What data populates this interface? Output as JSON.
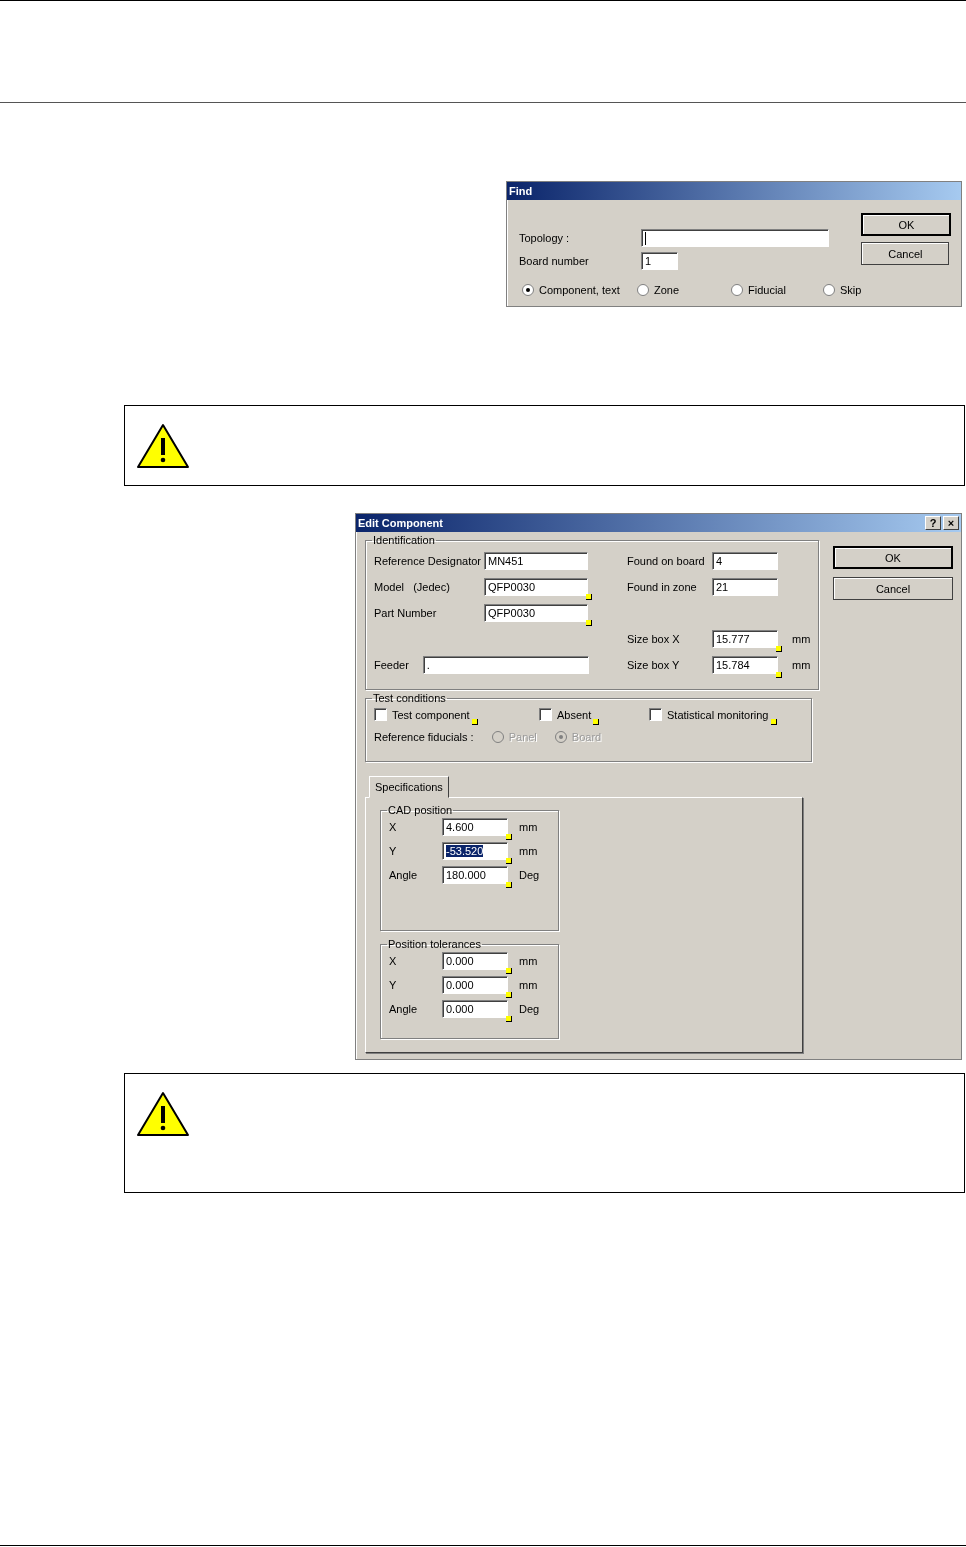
{
  "find_dialog": {
    "title": "Find",
    "fields": [
      {
        "label": "Topology :",
        "focused": true
      },
      {
        "label": "Board number",
        "value": "1",
        "focused": false
      }
    ],
    "options": [
      {
        "label": "Component, text",
        "selected": true
      },
      {
        "label": "Zone",
        "selected": false
      },
      {
        "label": "Fiducial",
        "selected": false
      },
      {
        "label": "Skip",
        "selected": false
      }
    ],
    "buttons": [
      {
        "label": "OK",
        "default": true
      },
      {
        "label": "Cancel",
        "default": false
      }
    ]
  },
  "notes": [
    {
      "kind": "warning"
    },
    {
      "kind": "warning"
    }
  ],
  "edit_dialog": {
    "title": "Edit Component",
    "title_buttons": [
      "?",
      "×"
    ],
    "identification": {
      "title": "Identification",
      "left_fields": [
        {
          "label": "Reference Designator",
          "value": "MN451",
          "marked": false
        },
        {
          "label": "Model   (Jedec)",
          "value": "QFP0030",
          "marked": true
        },
        {
          "label": "Part Number",
          "value": "QFP0030",
          "marked": true
        }
      ],
      "feeder": {
        "label": "Feeder",
        "value": ".",
        "marked": false
      },
      "right_fields": [
        {
          "label": "Found on board",
          "value": "4",
          "marked": false
        },
        {
          "label": "Found in zone",
          "value": "21",
          "marked": false
        }
      ],
      "size_fields": [
        {
          "label": "Size box X",
          "value": "15.777",
          "unit": "mm",
          "marked": true
        },
        {
          "label": "Size box Y",
          "value": "15.784",
          "unit": "mm",
          "marked": true
        }
      ]
    },
    "test_conditions": {
      "title": "Test conditions",
      "checkboxes": [
        {
          "label": "Test component",
          "checked": false,
          "marked": true
        },
        {
          "label": "Absent",
          "checked": false,
          "marked": true
        },
        {
          "label": "Statistical monitoring",
          "checked": false,
          "marked": true
        }
      ],
      "fiducials_label": "Reference fiducials :",
      "fiducials": [
        {
          "label": "Panel",
          "selected": false,
          "disabled": true
        },
        {
          "label": "Board",
          "selected": true,
          "disabled": true
        }
      ]
    },
    "tabs": [
      {
        "label": "Specifications",
        "selected": true
      }
    ],
    "groups": [
      {
        "title": "CAD position",
        "rows": [
          {
            "label": "X",
            "value": "4.600",
            "unit": "mm",
            "highlighted": false,
            "marked": true
          },
          {
            "label": "Y",
            "value": "-53.520",
            "unit": "mm",
            "highlighted": true,
            "marked": true
          },
          {
            "label": "Angle",
            "value": "180.000",
            "unit": "Deg",
            "highlighted": false,
            "marked": true
          }
        ]
      },
      {
        "title": "Position tolerances",
        "rows": [
          {
            "label": "X",
            "value": "0.000",
            "unit": "mm",
            "highlighted": false,
            "marked": true
          },
          {
            "label": "Y",
            "value": "0.000",
            "unit": "mm",
            "highlighted": false,
            "marked": true
          },
          {
            "label": "Angle",
            "value": "0.000",
            "unit": "Deg",
            "highlighted": false,
            "marked": true
          }
        ]
      }
    ],
    "buttons": [
      {
        "label": "OK",
        "default": true
      },
      {
        "label": "Cancel",
        "default": false
      }
    ]
  }
}
